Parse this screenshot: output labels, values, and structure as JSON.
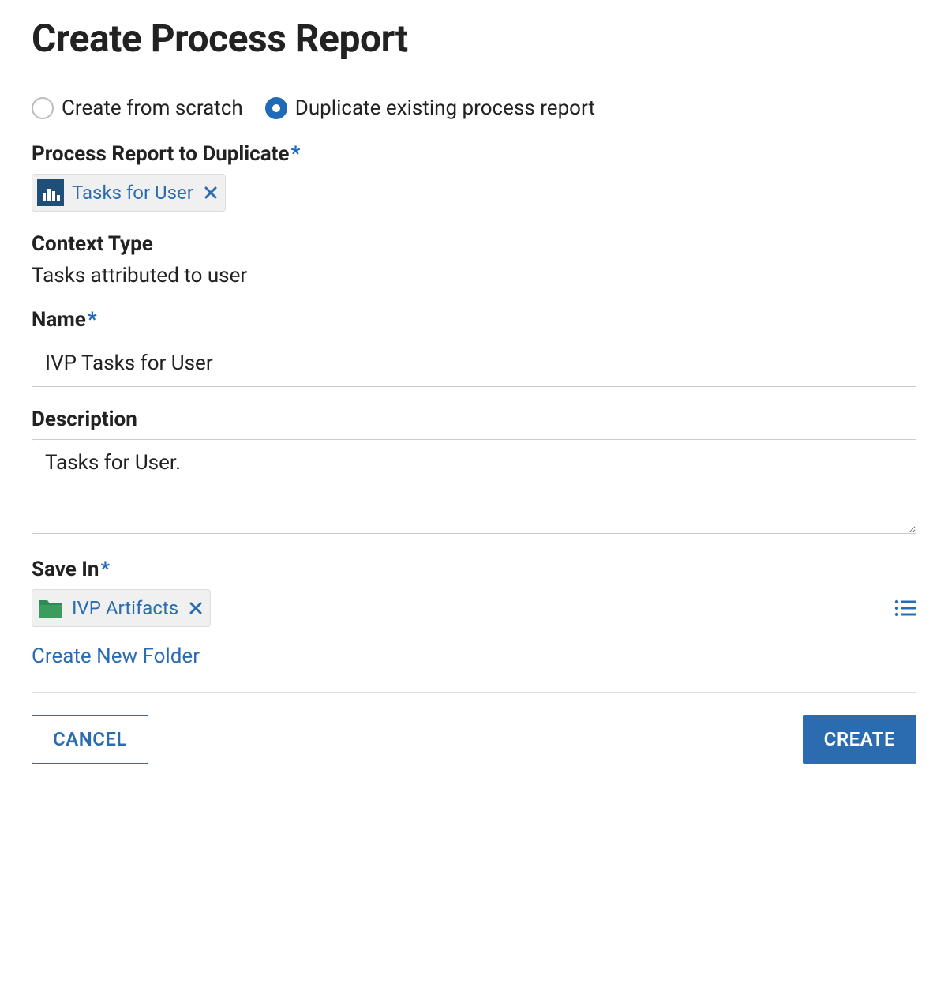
{
  "page": {
    "title": "Create Process Report"
  },
  "creation_mode": {
    "from_scratch_label": "Create from scratch",
    "duplicate_label": "Duplicate existing process report",
    "selected": "duplicate"
  },
  "duplicate_source": {
    "label": "Process Report to Duplicate",
    "required": true,
    "token": {
      "icon": "bar-chart-icon",
      "label": "Tasks for User"
    }
  },
  "context_type": {
    "label": "Context Type",
    "value": "Tasks attributed to user"
  },
  "name": {
    "label": "Name",
    "required": true,
    "value": "IVP Tasks for User"
  },
  "description": {
    "label": "Description",
    "value": "Tasks for User."
  },
  "save_in": {
    "label": "Save In",
    "required": true,
    "token": {
      "icon": "folder-icon",
      "label": "IVP Artifacts"
    },
    "create_folder_link": "Create New Folder"
  },
  "buttons": {
    "cancel": "CANCEL",
    "create": "CREATE"
  },
  "icons": {
    "bar_chart_color_bg": "#1f4e79",
    "folder_color": "#3a9d5d",
    "accent_color": "#2b6cb0"
  }
}
